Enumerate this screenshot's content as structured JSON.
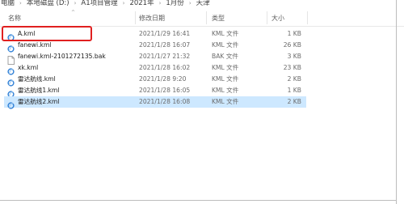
{
  "breadcrumb": [
    "电脑",
    "本地磁盘 (D:)",
    "A1项目管理",
    "2021年",
    "1月份",
    "天津"
  ],
  "columns": {
    "name": "名称",
    "modified": "修改日期",
    "type": "类型",
    "size": "大小"
  },
  "files": [
    {
      "name": "A.kml",
      "modified": "2021/1/29 16:41",
      "type": "KML 文件",
      "size": "1 KB",
      "icon": "kml-file-icon"
    },
    {
      "name": "fanewi.kml",
      "modified": "2021/1/28 16:07",
      "type": "KML 文件",
      "size": "26 KB",
      "icon": "kml-file-icon"
    },
    {
      "name": "fanewi.kml-2101272135.bak",
      "modified": "2021/1/27 21:32",
      "type": "BAK 文件",
      "size": "3 KB",
      "icon": "blank-file-icon"
    },
    {
      "name": "xk.kml",
      "modified": "2021/1/28 16:02",
      "type": "KML 文件",
      "size": "23 KB",
      "icon": "kml-file-icon"
    },
    {
      "name": "雷达航线.kml",
      "modified": "2021/1/28 9:20",
      "type": "KML 文件",
      "size": "2 KB",
      "icon": "kml-file-icon"
    },
    {
      "name": "雷达航线1.kml",
      "modified": "2021/1/28 16:05",
      "type": "KML 文件",
      "size": "1 KB",
      "icon": "kml-file-icon"
    },
    {
      "name": "雷达航线2.kml",
      "modified": "2021/1/28 16:08",
      "type": "KML 文件",
      "size": "2 KB",
      "icon": "kml-file-icon"
    }
  ],
  "selected_index": 6,
  "colors": {
    "selection": "#cde8ff",
    "highlight": "#e02020",
    "kml_icon": "#2f7fd6"
  }
}
